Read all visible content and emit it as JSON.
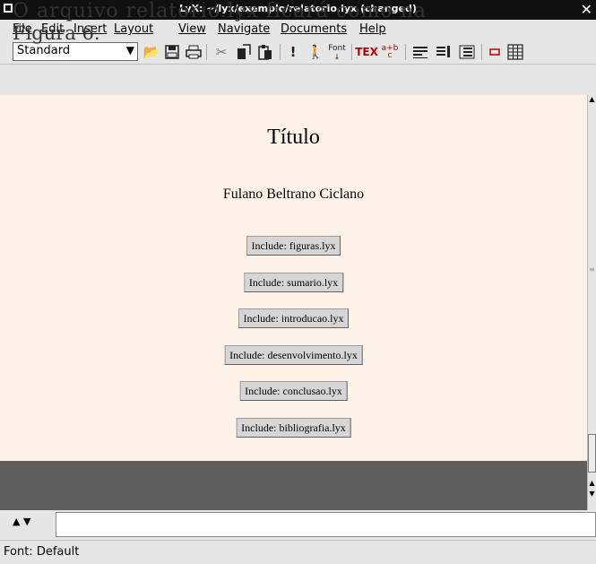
{
  "overlay": {
    "line1": "O arquivo relatorio.lyx ficará como na",
    "line2": "Figura 6."
  },
  "window": {
    "title": "LyX: ~/lyx/exemplo/relatorio.lyx (changed)"
  },
  "menubar": {
    "items": [
      "File",
      "Edit",
      "Insert",
      "Layout",
      "View",
      "Navigate",
      "Documents",
      "Help"
    ]
  },
  "toolbar": {
    "layout_value": "Standard",
    "font_label": "Font",
    "tex_label": "TEX"
  },
  "document": {
    "title": "Título",
    "author": "Fulano Beltrano Ciclano",
    "includes": [
      "Include: figuras.lyx",
      "Include: sumario.lyx",
      "Include: introducao.lyx",
      "Include: desenvolvimento.lyx",
      "Include: conclusao.lyx",
      "Include: bibliografia.lyx"
    ]
  },
  "minibuffer": {
    "value": ""
  },
  "statusbar": {
    "text": "Font: Default"
  }
}
